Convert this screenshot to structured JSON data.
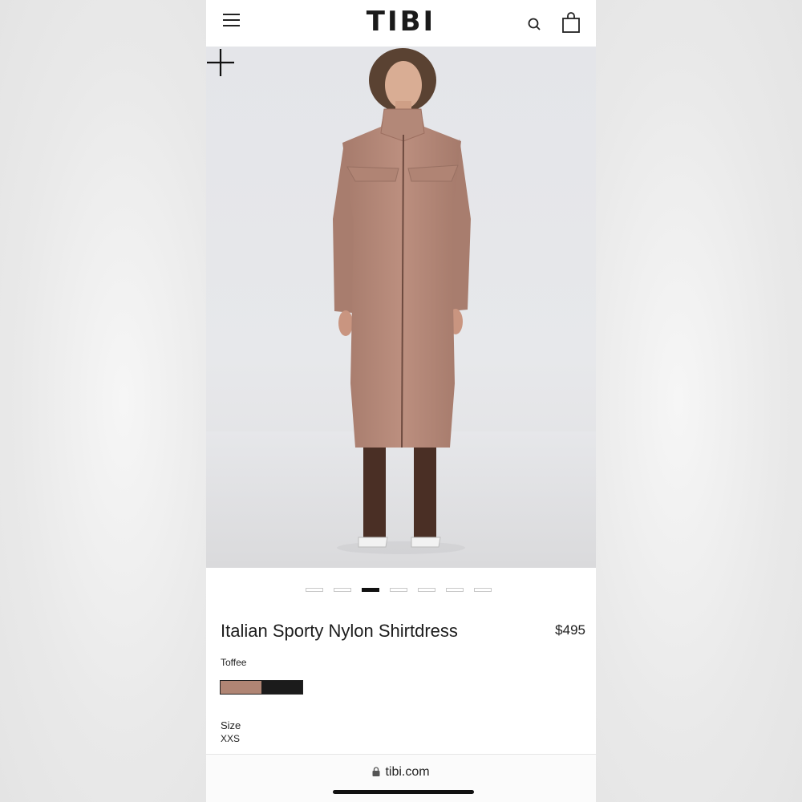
{
  "header": {
    "logo": "TIBI",
    "icons": {
      "menu": "hamburger-menu-icon",
      "search": "search-icon",
      "bag": "shopping-bag-icon"
    }
  },
  "hero": {
    "zoom_icon": "plus-icon",
    "image": "product-photo"
  },
  "carousel": {
    "count": 7,
    "active_index": 2
  },
  "product": {
    "title": "Italian Sporty Nylon Shirtdress",
    "price": "$495",
    "color_label": "Toffee",
    "swatches": [
      {
        "name": "Toffee",
        "color": "#b08574"
      },
      {
        "name": "Black",
        "color": "#1b1b1b"
      }
    ],
    "size_label": "Size",
    "size_value": "XXS"
  },
  "browser": {
    "url": "tibi.com",
    "lock_icon": "lock-icon"
  },
  "colors": {
    "accent": "#111111",
    "dress": "#b48878",
    "background": "#e6e7ea"
  }
}
